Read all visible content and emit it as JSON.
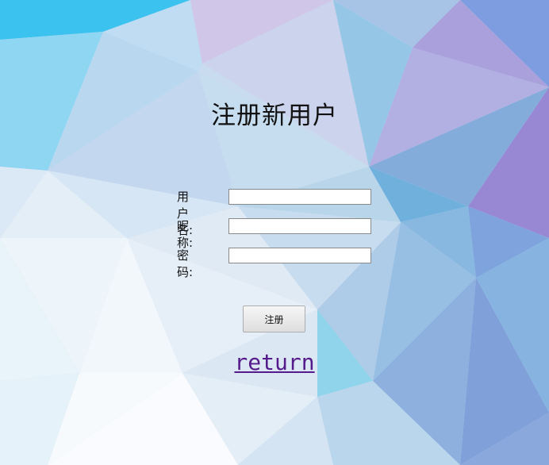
{
  "page": {
    "title": "注册新用户"
  },
  "form": {
    "username_label": "用户名:",
    "nickname_label": "昵称:",
    "password_label": "密码:",
    "username_value": "",
    "nickname_value": "",
    "password_value": "",
    "submit_label": "注册"
  },
  "nav": {
    "return_label": "return"
  },
  "colors": {
    "link_visited": "#551a8b",
    "cyan": "#3ec3ef",
    "lavender": "#c8bfe6",
    "purple": "#9a8fd6",
    "blue": "#7fa8d8"
  }
}
